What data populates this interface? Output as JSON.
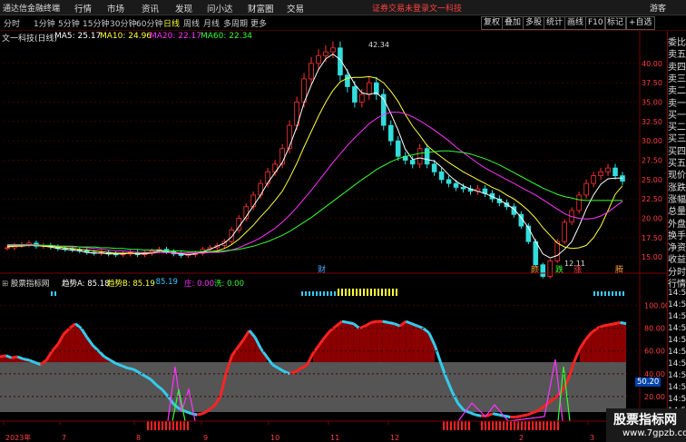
{
  "app": {
    "brand": "通达信金融终端",
    "menu": [
      "行情",
      "市场",
      "资讯",
      "发现",
      "问小达",
      "财富圈",
      "交易"
    ],
    "login_notice": "证券交易未登录",
    "stock_tab": "文一科技",
    "guest": "游客"
  },
  "toolbar": {
    "periods": [
      "分时",
      "1分钟",
      "5分钟",
      "15分钟",
      "30分钟",
      "60分钟",
      "日线",
      "周线",
      "月线",
      "多周期",
      "更多"
    ],
    "active_period": "日线",
    "right_buttons": [
      "复权",
      "叠加",
      "多股",
      "统计",
      "画线",
      "F10",
      "标记",
      "+自选"
    ]
  },
  "main_chart": {
    "title": "文一科技(日线)",
    "ma_labels": [
      {
        "text": "MA5: 25.17",
        "color": "#ffffff"
      },
      {
        "text": "MA10: 24.96",
        "color": "#ffff33"
      },
      {
        "text": "MA20: 22.17",
        "color": "#ff33ff"
      },
      {
        "text": "MA60: 22.34",
        "color": "#33ff33"
      }
    ],
    "high_label": "42.34",
    "low_label": "12.11",
    "event_markers": [
      {
        "text": "财",
        "color": "#4da6ff"
      },
      {
        "text": "颜",
        "color": "#ff9933"
      },
      {
        "text": "跌",
        "color": "#33ff33"
      },
      {
        "text": "涨",
        "color": "#ff4444"
      },
      {
        "text": "腾",
        "color": "#ff9933"
      }
    ]
  },
  "indicator": {
    "title": "股票指标网",
    "labels": [
      {
        "text": "趋势A: 85.18",
        "color": "#ffffff"
      },
      {
        "text": "趋势B: 85.19",
        "color": "#ffff33"
      },
      {
        "text": ": 85.19",
        "color": "#33ccff"
      },
      {
        "text": "庄: 0.00",
        "color": "#ff33ff"
      },
      {
        "text": "洗: 0.00",
        "color": "#33ff33"
      }
    ],
    "current_value": "50.20"
  },
  "date_axis": [
    "2023年",
    "7",
    "8",
    "9",
    "10",
    "11",
    "12",
    "2",
    "3"
  ],
  "side_panel": [
    "委比",
    "卖五",
    "卖四",
    "卖三",
    "卖二",
    "卖一",
    "买一",
    "买二",
    "买三",
    "买四",
    "买五",
    "现价",
    "涨跌",
    "涨幅",
    "总量",
    "外盘",
    "换手",
    "净资",
    "收益",
    "分时",
    "行情"
  ],
  "side_times": [
    "14:5",
    "14:5",
    "14:5",
    "14:5",
    "14:5",
    "14:5",
    "14:5",
    "14:5",
    "14:5",
    "14:5",
    "14:5"
  ],
  "watermark": {
    "title": "股票指标网",
    "url": "www.7gpzb.com"
  },
  "chart_data": [
    {
      "type": "candlestick",
      "yticks": [
        15.0,
        17.5,
        20.0,
        22.5,
        25.0,
        27.5,
        30.0,
        32.5,
        35.0,
        37.5,
        40.0
      ],
      "ylim": [
        13.5,
        43.5
      ],
      "close_profile": [
        16.2,
        16.5,
        16.6,
        16.8,
        16.4,
        16.5,
        16.3,
        16.1,
        16.0,
        15.9,
        15.8,
        15.6,
        15.5,
        15.6,
        15.4,
        15.3,
        15.4,
        15.6,
        15.3,
        15.5,
        15.8,
        16.0,
        15.7,
        15.4,
        15.2,
        15.3,
        15.5,
        16.0,
        16.2,
        16.5,
        17.0,
        18.5,
        20.0,
        21.5,
        23.0,
        24.5,
        26.0,
        27.0,
        29.0,
        32.0,
        35.0,
        38.0,
        40.0,
        41.0,
        41.5,
        42.0,
        38.5,
        37.0,
        35.0,
        36.0,
        37.5,
        36.0,
        32.0,
        30.0,
        28.0,
        27.5,
        27.0,
        29.0,
        27.0,
        26.0,
        25.0,
        24.5,
        24.0,
        23.8,
        23.5,
        23.8,
        23.2,
        22.5,
        22.0,
        21.5,
        20.5,
        19.0,
        17.0,
        14.0,
        12.5,
        14.5,
        17.0,
        19.5,
        21.0,
        23.0,
        24.5,
        25.5,
        26.0,
        26.5,
        25.5,
        24.8
      ],
      "ma5": [
        16.3,
        16.4,
        16.5,
        16.6,
        16.5,
        16.4,
        16.3,
        16.1,
        16.0,
        15.9,
        15.8,
        15.6,
        15.5,
        15.5,
        15.4,
        15.4,
        15.4,
        15.5,
        15.4,
        15.5,
        15.6,
        15.8,
        15.7,
        15.5,
        15.4,
        15.3,
        15.4,
        15.7,
        16.0,
        16.4,
        16.8,
        17.6,
        18.9,
        20.2,
        21.6,
        23.0,
        24.6,
        25.9,
        27.2,
        29.3,
        31.8,
        34.9,
        37.2,
        39.2,
        40.6,
        41.2,
        40.5,
        39.0,
        37.3,
        36.2,
        36.0,
        36.2,
        35.4,
        33.5,
        31.4,
        28.9,
        27.6,
        27.8,
        27.6,
        27.4,
        26.6,
        25.6,
        24.8,
        24.2,
        23.8,
        23.5,
        23.2,
        22.8,
        22.4,
        21.8,
        21.2,
        20.1,
        18.8,
        17.0,
        15.4,
        14.9,
        15.2,
        16.0,
        17.0,
        19.0,
        21.2,
        23.0,
        24.4,
        25.1,
        25.2,
        25.2
      ],
      "ma10": [
        16.4,
        16.4,
        16.4,
        16.5,
        16.5,
        16.4,
        16.4,
        16.3,
        16.2,
        16.1,
        16.0,
        15.9,
        15.8,
        15.7,
        15.6,
        15.5,
        15.5,
        15.5,
        15.4,
        15.4,
        15.5,
        15.6,
        15.6,
        15.6,
        15.5,
        15.5,
        15.5,
        15.6,
        15.7,
        15.8,
        16.1,
        16.6,
        17.3,
        18.2,
        19.1,
        20.2,
        21.2,
        22.3,
        23.5,
        25.2,
        27.1,
        29.2,
        31.2,
        33.2,
        35.0,
        36.5,
        37.6,
        38.1,
        38.2,
        38.2,
        38.3,
        38.1,
        37.5,
        36.4,
        35.1,
        33.4,
        31.9,
        30.7,
        29.4,
        28.6,
        27.9,
        27.2,
        26.6,
        26.0,
        25.5,
        25.0,
        24.5,
        24.0,
        23.6,
        23.0,
        22.5,
        21.8,
        21.0,
        20.0,
        18.8,
        17.8,
        16.8,
        16.3,
        16.1,
        16.2,
        16.5,
        17.5,
        19.0,
        21.0,
        23.1,
        24.2
      ],
      "ma20": [
        16.6,
        16.6,
        16.6,
        16.6,
        16.6,
        16.5,
        16.5,
        16.4,
        16.4,
        16.3,
        16.3,
        16.2,
        16.1,
        16.0,
        15.9,
        15.8,
        15.8,
        15.7,
        15.6,
        15.6,
        15.6,
        15.6,
        15.6,
        15.5,
        15.5,
        15.5,
        15.5,
        15.5,
        15.6,
        15.6,
        15.7,
        15.9,
        16.2,
        16.6,
        17.0,
        17.5,
        18.1,
        18.7,
        19.5,
        20.4,
        21.4,
        22.5,
        23.6,
        24.8,
        26.0,
        27.2,
        28.3,
        29.4,
        30.4,
        31.3,
        32.2,
        32.9,
        33.4,
        33.7,
        33.7,
        33.5,
        33.1,
        32.6,
        32.0,
        31.4,
        30.7,
        30.0,
        29.2,
        28.5,
        27.8,
        27.1,
        26.5,
        26.0,
        25.5,
        25.0,
        24.5,
        24.0,
        23.5,
        23.0,
        22.4,
        21.8,
        21.2,
        20.6,
        20.2,
        20.0,
        19.9,
        20.0,
        20.3,
        20.8,
        21.5,
        22.2
      ],
      "ma60": [
        16.5,
        16.5,
        16.5,
        16.5,
        16.5,
        16.5,
        16.5,
        16.4,
        16.4,
        16.4,
        16.3,
        16.3,
        16.3,
        16.2,
        16.2,
        16.1,
        16.1,
        16.0,
        16.0,
        15.9,
        15.9,
        15.9,
        15.8,
        15.8,
        15.8,
        15.7,
        15.7,
        15.7,
        15.7,
        15.7,
        15.8,
        15.9,
        16.0,
        16.2,
        16.4,
        16.7,
        17.0,
        17.4,
        17.8,
        18.3,
        18.9,
        19.5,
        20.1,
        20.8,
        21.5,
        22.2,
        22.9,
        23.6,
        24.3,
        25.0,
        25.6,
        26.3,
        26.8,
        27.3,
        27.7,
        28.0,
        28.2,
        28.4,
        28.5,
        28.6,
        28.7,
        28.7,
        28.6,
        28.5,
        28.3,
        28.0,
        27.7,
        27.3,
        26.9,
        26.4,
        25.9,
        25.4,
        24.9,
        24.4,
        23.9,
        23.5,
        23.1,
        22.8,
        22.6,
        22.4,
        22.3,
        22.3,
        22.3,
        22.3,
        22.3,
        22.3
      ]
    },
    {
      "type": "area",
      "yticks": [
        20.0,
        40.0,
        60.0,
        80.0,
        100.0
      ],
      "ylim": [
        0,
        110
      ],
      "midline": 50.2,
      "trend": [
        55,
        56,
        54,
        55,
        53,
        52,
        50,
        48,
        52,
        60,
        66,
        75,
        80,
        84,
        80,
        72,
        65,
        60,
        55,
        52,
        49,
        47,
        45,
        44,
        41,
        38,
        35,
        30,
        26,
        20,
        13,
        9,
        7,
        5,
        4,
        5,
        8,
        12,
        20,
        40,
        56,
        63,
        70,
        78,
        72,
        62,
        55,
        48,
        45,
        42,
        40,
        42,
        45,
        48,
        58,
        65,
        72,
        78,
        82,
        86,
        85,
        84,
        80,
        82,
        85,
        86,
        86,
        85,
        84,
        82,
        86,
        84,
        82,
        80,
        76,
        65,
        50,
        36,
        24,
        14,
        8,
        6,
        4,
        3,
        3,
        5,
        4,
        3,
        2,
        2,
        3,
        4,
        6,
        8,
        12,
        16,
        20,
        25,
        35,
        50,
        62,
        70,
        76,
        80,
        82,
        83,
        84,
        85,
        84
      ]
    }
  ]
}
